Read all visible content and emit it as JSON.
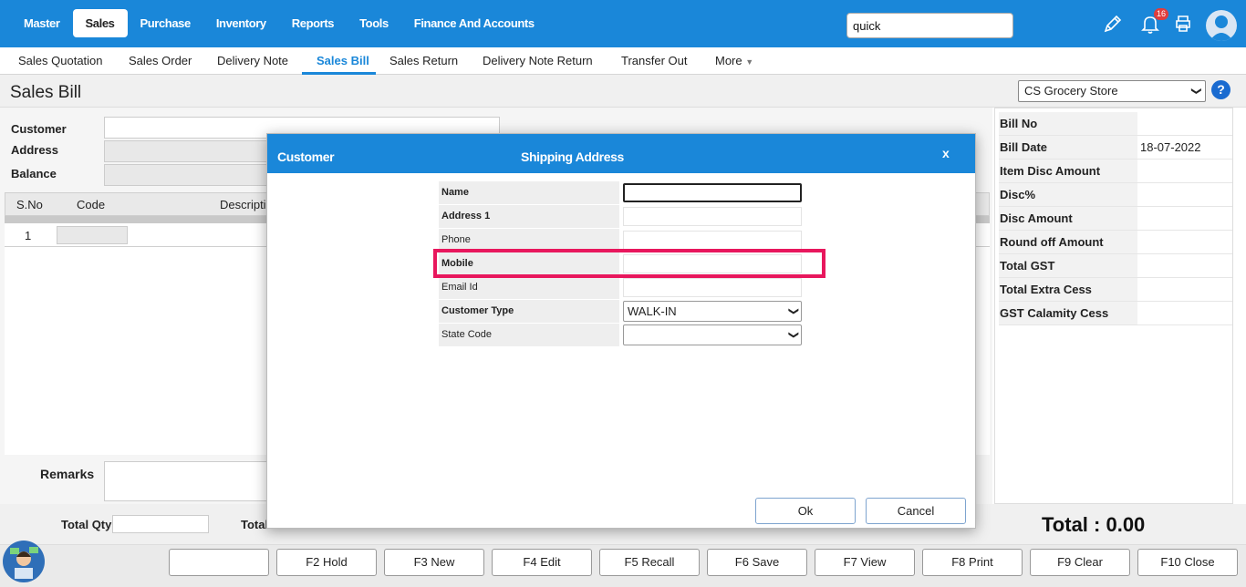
{
  "topnav": {
    "menu": [
      "Master",
      "Sales",
      "Purchase",
      "Inventory",
      "Reports",
      "Tools",
      "Finance And Accounts"
    ],
    "active": "Sales",
    "search_value": "quick",
    "notification_count": "16"
  },
  "subnav": {
    "tabs": [
      "Sales Quotation",
      "Sales Order",
      "Delivery Note",
      "Sales Bill",
      "Sales Return",
      "Delivery Note Return",
      "Transfer Out",
      "More"
    ],
    "active": "Sales Bill"
  },
  "page": {
    "title": "Sales Bill",
    "store": "CS Grocery Store",
    "help": "?"
  },
  "form": {
    "customer_label": "Customer",
    "address_label": "Address",
    "balance_label": "Balance"
  },
  "grid": {
    "headers": [
      "S.No",
      "Code",
      "Descripti"
    ],
    "rows": [
      {
        "sno": "1"
      }
    ]
  },
  "remarks_label": "Remarks",
  "summary": [
    {
      "label": "Bill No",
      "value": ""
    },
    {
      "label": "Bill Date",
      "value": "18-07-2022"
    },
    {
      "label": "Item Disc Amount",
      "value": ""
    },
    {
      "label": "Disc%",
      "value": ""
    },
    {
      "label": "Disc Amount",
      "value": ""
    },
    {
      "label": "Round off Amount",
      "value": ""
    },
    {
      "label": "Total GST",
      "value": ""
    },
    {
      "label": "Total Extra Cess",
      "value": ""
    },
    {
      "label": "GST Calamity Cess",
      "value": ""
    }
  ],
  "totals": {
    "total_qty_label": "Total Qty",
    "total_label_partial": "Total",
    "grand_total": "Total : 0.00"
  },
  "footer_buttons": [
    "",
    "F2 Hold",
    "F3 New",
    "F4 Edit",
    "F5 Recall",
    "F6 Save",
    "F7 View",
    "F8 Print",
    "F9 Clear",
    "F10 Close"
  ],
  "modal": {
    "title_left": "Customer",
    "title_center": "Shipping Address",
    "close": "x",
    "fields": [
      {
        "label": "Name",
        "bold": true,
        "value": ""
      },
      {
        "label": "Address 1",
        "bold": true,
        "value": ""
      },
      {
        "label": "Phone",
        "bold": false,
        "value": ""
      },
      {
        "label": "Mobile",
        "bold": true,
        "value": ""
      },
      {
        "label": "Email Id",
        "bold": false,
        "value": ""
      },
      {
        "label": "Customer Type",
        "bold": true,
        "value": "WALK-IN"
      },
      {
        "label": "State Code",
        "bold": false,
        "value": ""
      }
    ],
    "ok_label": "Ok",
    "cancel_label": "Cancel"
  },
  "colors": {
    "primary": "#1a87d9",
    "highlight": "#e8175d",
    "badge": "#e03d3d"
  }
}
